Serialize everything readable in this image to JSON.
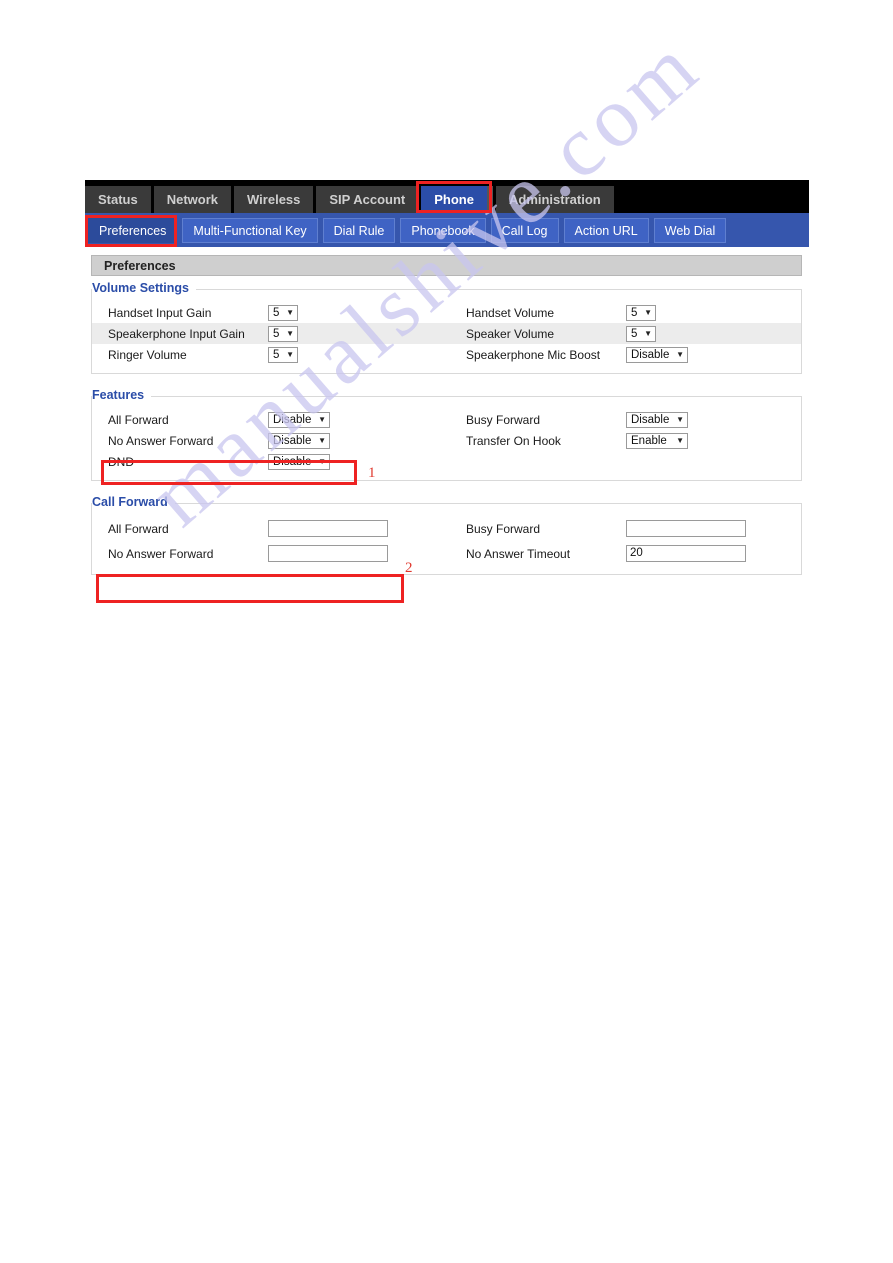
{
  "watermark": {
    "text": "manualshive.com"
  },
  "topnav": {
    "tabs": [
      {
        "label": "Status",
        "active": false
      },
      {
        "label": "Network",
        "active": false
      },
      {
        "label": "Wireless",
        "active": false
      },
      {
        "label": "SIP Account",
        "active": false
      },
      {
        "label": "Phone",
        "active": true
      },
      {
        "label": "Administration",
        "active": false
      }
    ]
  },
  "subnav": {
    "tabs": [
      {
        "label": "Preferences",
        "active": true
      },
      {
        "label": "Multi-Functional Key",
        "active": false
      },
      {
        "label": "Dial Rule",
        "active": false
      },
      {
        "label": "Phonebook",
        "active": false
      },
      {
        "label": "Call Log",
        "active": false
      },
      {
        "label": "Action URL",
        "active": false
      },
      {
        "label": "Web Dial",
        "active": false
      }
    ]
  },
  "page": {
    "title": "Preferences"
  },
  "volume_settings": {
    "legend": "Volume Settings",
    "rows": [
      {
        "left_label": "Handset Input Gain",
        "left_value": "5",
        "right_label": "Handset Volume",
        "right_value": "5"
      },
      {
        "left_label": "Speakerphone Input Gain",
        "left_value": "5",
        "right_label": "Speaker Volume",
        "right_value": "5"
      },
      {
        "left_label": "Ringer Volume",
        "left_value": "5",
        "right_label": "Speakerphone Mic Boost",
        "right_value": "Disable"
      }
    ]
  },
  "features": {
    "legend": "Features",
    "rows": [
      {
        "left_label": "All Forward",
        "left_value": "Disable",
        "right_label": "Busy Forward",
        "right_value": "Disable"
      },
      {
        "left_label": "No Answer Forward",
        "left_value": "Disable",
        "right_label": "Transfer On Hook",
        "right_value": "Enable"
      },
      {
        "left_label": "DND",
        "left_value": "Disable",
        "right_label": "",
        "right_value": ""
      }
    ]
  },
  "call_forward": {
    "legend": "Call Forward",
    "rows": [
      {
        "left_label": "All Forward",
        "left_value": "",
        "right_label": "Busy Forward",
        "right_value": ""
      },
      {
        "left_label": "No Answer Forward",
        "left_value": "",
        "right_label": "No Answer Timeout",
        "right_value": "20"
      }
    ]
  },
  "annotations": {
    "color": "#ee2222",
    "marker_one": "1",
    "marker_two": "2"
  },
  "icons": {
    "caret": "▼"
  }
}
